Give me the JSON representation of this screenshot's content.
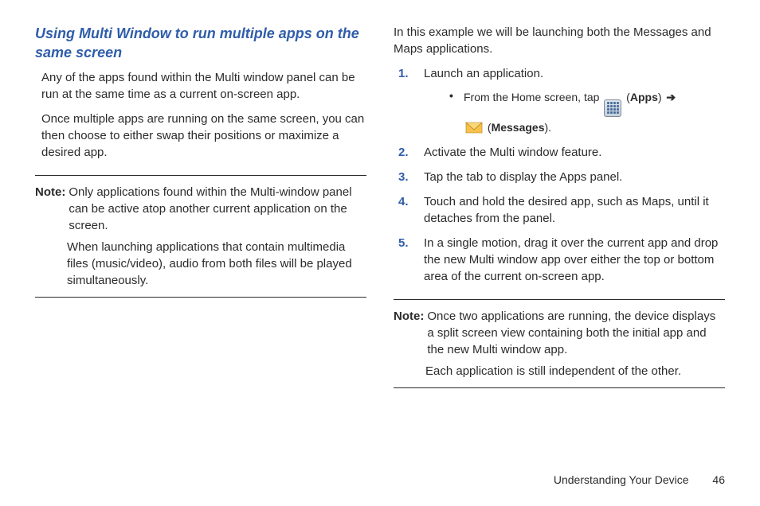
{
  "heading": "Using Multi Window to run multiple apps on the same screen",
  "p1": "Any of the apps found within the Multi window panel can be run at the same time as a current on-screen app.",
  "p2": "Once multiple apps are running on the same screen, you can then choose to either swap their positions or maximize a desired app.",
  "note1": {
    "label": "Note:",
    "a": "Only applications found within the Multi-window panel can be active atop another current application on the screen.",
    "b": "When launching applications that contain multimedia files (music/video), audio from both files will be played simultaneously."
  },
  "right_intro": "In this example we will be launching both the Messages and Maps applications.",
  "steps": {
    "n1": "1.",
    "s1": "Launch an application.",
    "sub_pre": "From the Home screen, tap",
    "apps_label": "Apps",
    "msgs_label": "Messages",
    "n2": "2.",
    "s2": "Activate the Multi window feature.",
    "n3": "3.",
    "s3": "Tap the tab to display the Apps panel.",
    "n4": "4.",
    "s4": "Touch and hold the desired app, such as Maps, until it detaches from the panel.",
    "n5": "5.",
    "s5": "In a single motion, drag it over the current app and drop the new Multi window app over either the top or bottom area of the current on-screen app."
  },
  "note2": {
    "label": "Note:",
    "a": "Once two applications are running, the device displays a split screen view containing both the initial app and the new Multi window app.",
    "b": "Each application is still independent of the other."
  },
  "footer_section": "Understanding Your Device",
  "footer_page": "46"
}
